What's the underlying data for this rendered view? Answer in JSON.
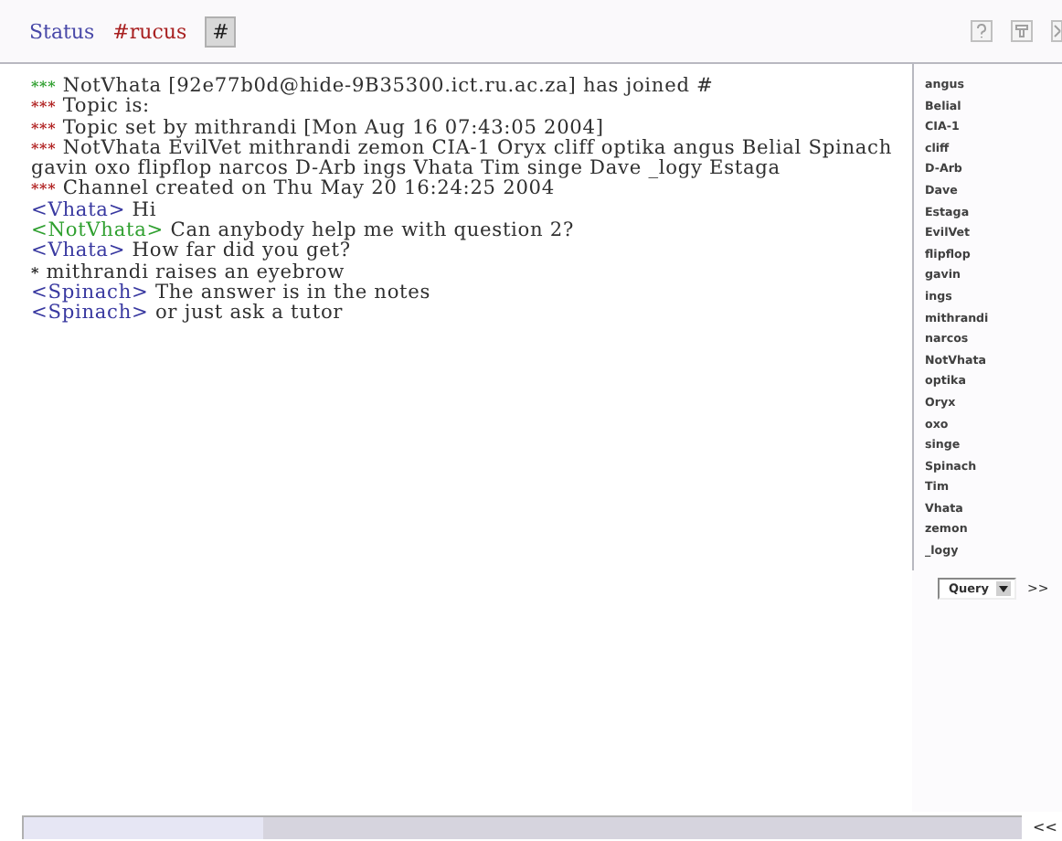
{
  "tabs": [
    {
      "label": "Status",
      "color": "#4848a8",
      "selected": false
    },
    {
      "label": "#rucus",
      "color": "#a82020",
      "selected": false
    },
    {
      "label": "#",
      "color": "#202020",
      "selected": true
    }
  ],
  "messages": [
    {
      "kind": "system",
      "marker": "***",
      "color": "#30a030",
      "text": "NotVhata [92e77b0d@hide-9B35300.ict.ru.ac.za] has joined #"
    },
    {
      "kind": "system",
      "marker": "***",
      "color": "#b02020",
      "text": "Topic is:"
    },
    {
      "kind": "system",
      "marker": "***",
      "color": "#b02020",
      "text": "Topic set by mithrandi [Mon Aug 16 07:43:05 2004]"
    },
    {
      "kind": "system",
      "marker": "***",
      "color": "#b02020",
      "text": "NotVhata EvilVet mithrandi zemon CIA-1 Oryx cliff optika angus Belial Spinach gavin oxo flipflop narcos D-Arb ings Vhata Tim singe Dave _logy Estaga"
    },
    {
      "kind": "system",
      "marker": "***",
      "color": "#b02020",
      "text": "Channel created on Thu May 20 16:24:25 2004"
    },
    {
      "kind": "chat",
      "nick": "<Vhata>",
      "color": "#3838a0",
      "text": "Hi"
    },
    {
      "kind": "chat",
      "nick": "<NotVhata>",
      "color": "#30a030",
      "text": "Can anybody help me with question 2?"
    },
    {
      "kind": "chat",
      "nick": "<Vhata>",
      "color": "#3838a0",
      "text": "How far did you get?"
    },
    {
      "kind": "action",
      "marker": "*",
      "color": "#202020",
      "text": "mithrandi raises an eyebrow"
    },
    {
      "kind": "chat",
      "nick": "<Spinach>",
      "color": "#3838a0",
      "text": "The answer is in the notes"
    },
    {
      "kind": "chat",
      "nick": "<Spinach>",
      "color": "#3838a0",
      "text": "or just ask a tutor"
    }
  ],
  "nicks": [
    "angus",
    "Belial",
    "CIA-1",
    "cliff",
    "D-Arb",
    "Dave",
    "Estaga",
    "EvilVet",
    "flipflop",
    "gavin",
    "ings",
    "mithrandi",
    "narcos",
    "NotVhata",
    "optika",
    "Oryx",
    "oxo",
    "singe",
    "Spinach",
    "Tim",
    "Vhata",
    "zemon",
    "_logy"
  ],
  "query_select": {
    "value": "Query"
  },
  "more_button": ">>",
  "collapse_button": "<<"
}
